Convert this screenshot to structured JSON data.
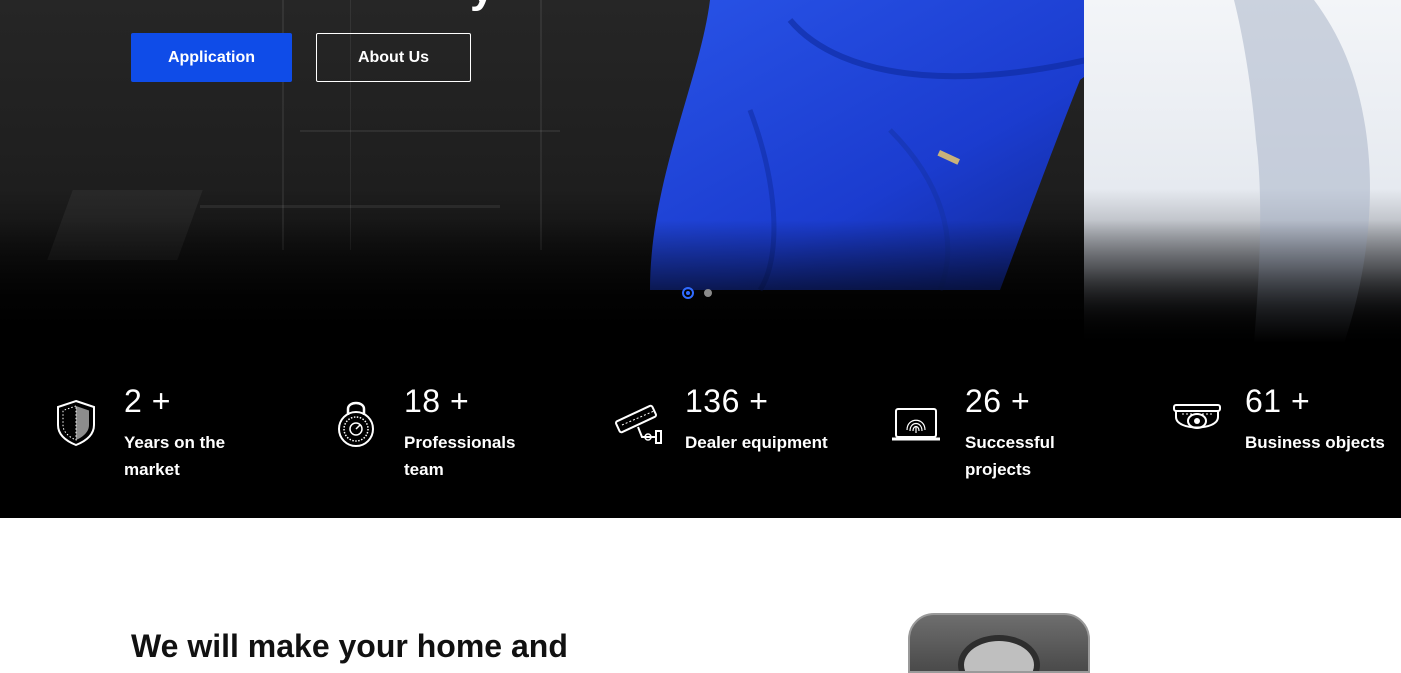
{
  "hero": {
    "title_fragment": "y",
    "buttons": {
      "primary_label": "Application",
      "secondary_label": "About Us"
    },
    "slider": {
      "active_index": 1,
      "total": 2
    }
  },
  "stats": [
    {
      "number": "2",
      "suffix": "+",
      "label": "Years on the market",
      "icon": "shield-icon"
    },
    {
      "number": "18",
      "suffix": "+",
      "label": "Professionals team",
      "icon": "padlock-icon"
    },
    {
      "number": "136",
      "suffix": "+",
      "label": "Dealer equipment",
      "icon": "cctv-camera-icon"
    },
    {
      "number": "26",
      "suffix": "+",
      "label": "Successful projects",
      "icon": "fingerprint-laptop-icon"
    },
    {
      "number": "61",
      "suffix": "+",
      "label": "Business objects",
      "icon": "dome-camera-icon"
    }
  ],
  "section": {
    "headline": "We will make your home and"
  },
  "colors": {
    "accent": "#0f4ce8",
    "dot_active": "#2f6bff",
    "stats_bg": "#000000",
    "uniform": "#1d3fd6"
  }
}
